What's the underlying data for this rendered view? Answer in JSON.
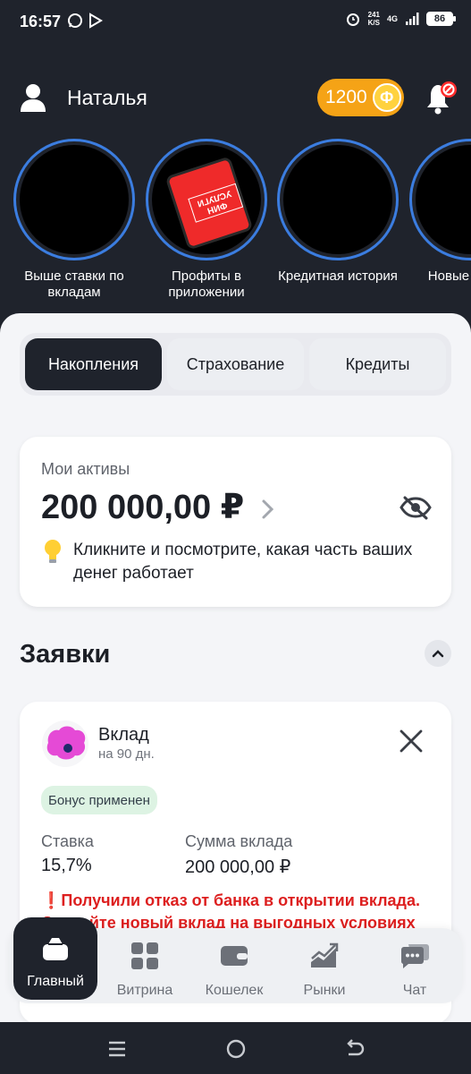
{
  "status": {
    "time": "16:57",
    "speed_value": "241",
    "speed_unit": "K/S",
    "network": "4G",
    "battery": "86"
  },
  "header": {
    "user_name": "Наталья",
    "coins": "1200",
    "coin_symbol": "Ф"
  },
  "stories": [
    {
      "label": "Выше ставки по вкладам"
    },
    {
      "label": "Профиты в приложении",
      "image_text": "ФИН УСЛУГИ"
    },
    {
      "label": "Кредитная история"
    },
    {
      "label": "Новые в НДС"
    }
  ],
  "tabs": [
    "Накопления",
    "Страхование",
    "Кредиты"
  ],
  "assets": {
    "label": "Мои активы",
    "amount": "200 000,00 ₽",
    "hint": "Кликните и посмотрите, какая часть ваших денег работает"
  },
  "requests": {
    "title": "Заявки",
    "deposit": {
      "title": "Вклад",
      "subtitle": "на 90 дн.",
      "badge": "Бонус применен",
      "rate_label": "Ставка",
      "rate_value": "15,7%",
      "sum_label": "Сумма вклада",
      "sum_value": "200 000,00 ₽",
      "warning": "❗Получили отказ от банка в открытии вклада. Откройте новый вклад на выгодных условиях"
    }
  },
  "nav": [
    "Главный",
    "Витрина",
    "Кошелек",
    "Рынки",
    "Чат"
  ],
  "colors": {
    "dark_bg": "#1f232c",
    "accent_orange": "#f5a316",
    "story_ring": "#3b7de0",
    "warning_red": "#dd1f1f"
  }
}
